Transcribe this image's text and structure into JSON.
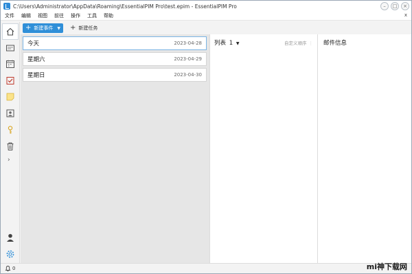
{
  "window": {
    "title": "C:\\Users\\Administrator\\AppData\\Roaming\\EssentialPIM Pro\\test.epim - EssentialPIM Pro",
    "minimize": "–",
    "maximize": "□",
    "close": "×"
  },
  "menu": {
    "items": [
      "文件",
      "编辑",
      "视图",
      "前往",
      "操作",
      "工具",
      "帮助"
    ],
    "close": "x"
  },
  "toolbar": {
    "new_event_label": "新建事件",
    "new_task_label": "新建任务"
  },
  "sidebar": {
    "icons": [
      "home-icon",
      "inbox-icon",
      "calendar-icon",
      "tasks-icon",
      "notes-icon",
      "contacts-icon",
      "password-icon",
      "trash-icon",
      "user-icon",
      "settings-icon"
    ],
    "accent": "#2f8fd8"
  },
  "days": [
    {
      "label": "今天",
      "date": "2023-04-28"
    },
    {
      "label": "星期六",
      "date": "2023-04-29"
    },
    {
      "label": "星期日",
      "date": "2023-04-30"
    }
  ],
  "middle": {
    "list_label": "列表",
    "list_number": "1",
    "custom_sort": "自定义顺序"
  },
  "right": {
    "title": "邮件信息"
  },
  "status": {
    "bell_count": "0"
  },
  "watermark": "mi神下载网"
}
